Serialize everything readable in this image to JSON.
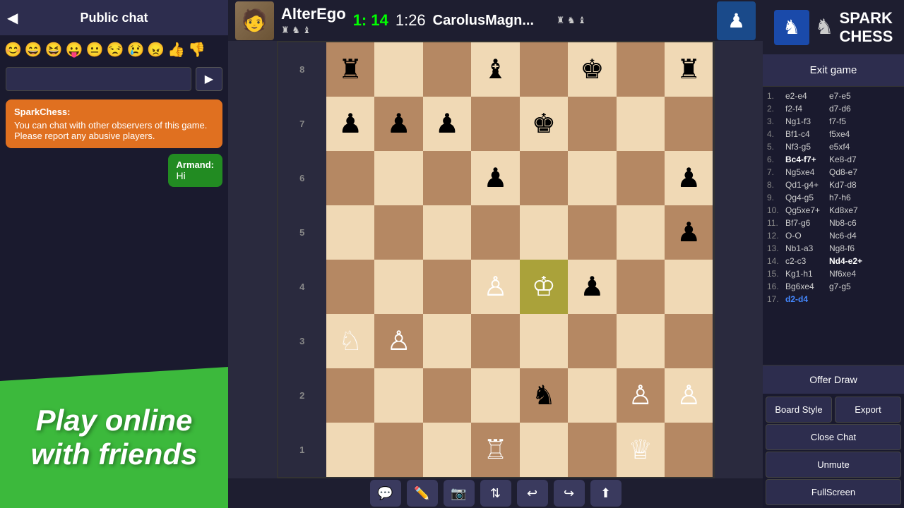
{
  "chat": {
    "title": "Public chat",
    "back_label": "◀",
    "emojis": [
      "😊",
      "😄",
      "😆",
      "😛",
      "😐",
      "😒",
      "😢",
      "😠",
      "👍",
      "👎"
    ],
    "input_placeholder": "",
    "send_label": "▶",
    "messages": [
      {
        "type": "system",
        "sender": "SparkChess:",
        "text": "You can chat with other observers of this game. Please report any abusive players."
      },
      {
        "type": "user",
        "sender": "Armand:",
        "text": "Hi"
      }
    ]
  },
  "promo": {
    "line1": "Play online",
    "line2": "with friends"
  },
  "game": {
    "player1_name": "AlterEgo",
    "player1_timer": "1: 14",
    "timer_sep": "1:26",
    "player2_name": "CarolusMagn...",
    "player1_pieces": "♜ ♞ ♝",
    "player2_pieces": "♜ ♞ ♝",
    "avatar_emoji": "🧑"
  },
  "moves": [
    {
      "num": "1.",
      "w": "e2-e4",
      "b": "e7-e5"
    },
    {
      "num": "2.",
      "w": "f2-f4",
      "b": "d7-d6"
    },
    {
      "num": "3.",
      "w": "Ng1-f3",
      "b": "f7-f5"
    },
    {
      "num": "4.",
      "w": "Bf1-c4",
      "b": "f5xe4"
    },
    {
      "num": "5.",
      "w": "Nf3-g5",
      "b": "e5xf4"
    },
    {
      "num": "6.",
      "w": "Bc4-f7+",
      "b": "Ke8-d7",
      "w_bold": true
    },
    {
      "num": "7.",
      "w": "Ng5xe4",
      "b": "Qd8-e7"
    },
    {
      "num": "8.",
      "w": "Qd1-g4+",
      "b": "Kd7-d8"
    },
    {
      "num": "9.",
      "w": "Qg4-g5",
      "b": "h7-h6"
    },
    {
      "num": "10.",
      "w": "Qg5xe7+",
      "b": "Kd8xe7"
    },
    {
      "num": "11.",
      "w": "Bf7-g6",
      "b": "Nb8-c6"
    },
    {
      "num": "12.",
      "w": "O-O",
      "b": "Nc6-d4"
    },
    {
      "num": "13.",
      "w": "Nb1-a3",
      "b": "Ng8-f6"
    },
    {
      "num": "14.",
      "w": "c2-c3",
      "b": "Nd4-e2+",
      "b_bold": true
    },
    {
      "num": "15.",
      "w": "Kg1-h1",
      "b": "Nf6xe4"
    },
    {
      "num": "16.",
      "w": "Bg6xe4",
      "b": "g7-g5"
    },
    {
      "num": "17.",
      "w": "d2-d4",
      "b": "",
      "w_highlight": true
    }
  ],
  "logo": {
    "title": "SPARK CHESS",
    "spark": "SPARK",
    "chess": "CHESS"
  },
  "buttons": {
    "exit_game": "Exit game",
    "offer_draw": "Offer Draw",
    "board_style": "Board Style",
    "export": "Export",
    "close_chat": "Close Chat",
    "unmute": "Unmute",
    "fullscreen": "FullScreen"
  },
  "toolbar": {
    "icons": [
      "💬",
      "✏️",
      "📷",
      "⇅",
      "↩",
      "↪",
      "⬆"
    ]
  }
}
